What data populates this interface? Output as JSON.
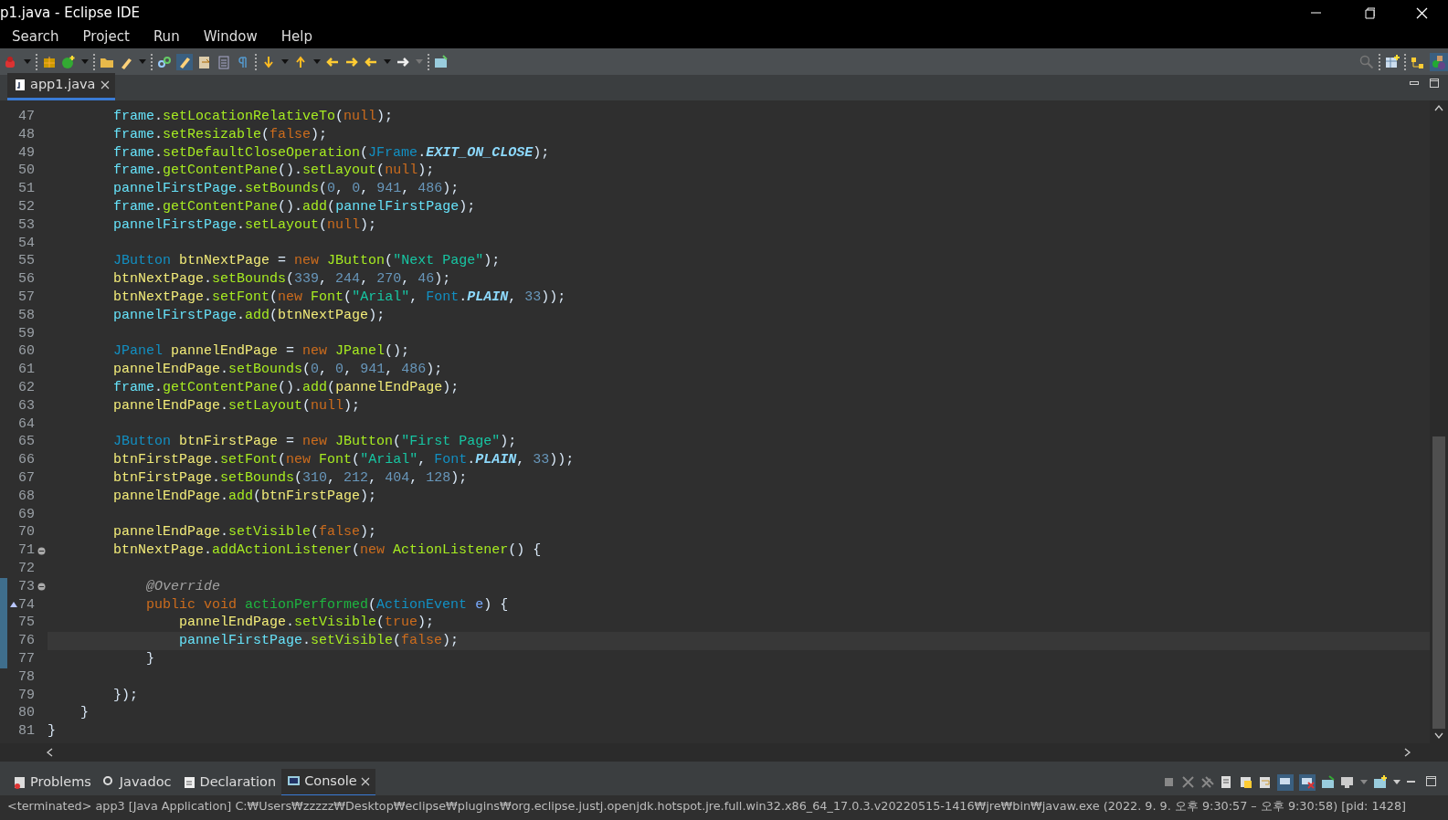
{
  "window": {
    "title": "p1.java - Eclipse IDE"
  },
  "menu": [
    "Search",
    "Project",
    "Run",
    "Window",
    "Help"
  ],
  "editor_tabs": [
    {
      "label": "app1.java",
      "selected": true
    }
  ],
  "code_lines": [
    {
      "number": "47",
      "current": false,
      "changed": false,
      "fold": false,
      "override": false,
      "tokens": [
        {
          "kind": "f",
          "text": "        frame"
        },
        {
          "kind": "p",
          "text": "."
        },
        {
          "kind": "m",
          "text": "setLocationRelativeTo"
        },
        {
          "kind": "p",
          "text": "("
        },
        {
          "kind": "k",
          "text": "null"
        },
        {
          "kind": "p",
          "text": ");"
        }
      ]
    },
    {
      "number": "48",
      "current": false,
      "changed": false,
      "fold": false,
      "override": false,
      "tokens": [
        {
          "kind": "f",
          "text": "        frame"
        },
        {
          "kind": "p",
          "text": "."
        },
        {
          "kind": "m",
          "text": "setResizable"
        },
        {
          "kind": "p",
          "text": "("
        },
        {
          "kind": "k",
          "text": "false"
        },
        {
          "kind": "p",
          "text": ");"
        }
      ]
    },
    {
      "number": "49",
      "current": false,
      "changed": false,
      "fold": false,
      "override": false,
      "tokens": [
        {
          "kind": "f",
          "text": "        frame"
        },
        {
          "kind": "p",
          "text": "."
        },
        {
          "kind": "m",
          "text": "setDefaultCloseOperation"
        },
        {
          "kind": "p",
          "text": "("
        },
        {
          "kind": "t",
          "text": "JFrame"
        },
        {
          "kind": "p",
          "text": "."
        },
        {
          "kind": "c",
          "text": "EXIT_ON_CLOSE"
        },
        {
          "kind": "p",
          "text": ");"
        }
      ]
    },
    {
      "number": "50",
      "current": false,
      "changed": false,
      "fold": false,
      "override": false,
      "tokens": [
        {
          "kind": "f",
          "text": "        frame"
        },
        {
          "kind": "p",
          "text": "."
        },
        {
          "kind": "m",
          "text": "getContentPane"
        },
        {
          "kind": "p",
          "text": "()."
        },
        {
          "kind": "m",
          "text": "setLayout"
        },
        {
          "kind": "p",
          "text": "("
        },
        {
          "kind": "k",
          "text": "null"
        },
        {
          "kind": "p",
          "text": ");"
        }
      ]
    },
    {
      "number": "51",
      "current": false,
      "changed": false,
      "fold": false,
      "override": false,
      "tokens": [
        {
          "kind": "f",
          "text": "        pannelFirstPage"
        },
        {
          "kind": "p",
          "text": "."
        },
        {
          "kind": "m",
          "text": "setBounds"
        },
        {
          "kind": "p",
          "text": "("
        },
        {
          "kind": "n",
          "text": "0"
        },
        {
          "kind": "p",
          "text": ","
        },
        {
          "kind": "n",
          "text": " 0"
        },
        {
          "kind": "p",
          "text": ","
        },
        {
          "kind": "n",
          "text": " 941"
        },
        {
          "kind": "p",
          "text": ","
        },
        {
          "kind": "n",
          "text": " 486"
        },
        {
          "kind": "p",
          "text": ");"
        }
      ]
    },
    {
      "number": "52",
      "current": false,
      "changed": false,
      "fold": false,
      "override": false,
      "tokens": [
        {
          "kind": "f",
          "text": "        frame"
        },
        {
          "kind": "p",
          "text": "."
        },
        {
          "kind": "m",
          "text": "getContentPane"
        },
        {
          "kind": "p",
          "text": "()."
        },
        {
          "kind": "m",
          "text": "add"
        },
        {
          "kind": "p",
          "text": "("
        },
        {
          "kind": "f",
          "text": "pannelFirstPage"
        },
        {
          "kind": "p",
          "text": ");"
        }
      ]
    },
    {
      "number": "53",
      "current": false,
      "changed": false,
      "fold": false,
      "override": false,
      "tokens": [
        {
          "kind": "f",
          "text": "        pannelFirstPage"
        },
        {
          "kind": "p",
          "text": "."
        },
        {
          "kind": "m",
          "text": "setLayout"
        },
        {
          "kind": "p",
          "text": "("
        },
        {
          "kind": "k",
          "text": "null"
        },
        {
          "kind": "p",
          "text": ");"
        }
      ]
    },
    {
      "number": "54",
      "current": false,
      "changed": false,
      "fold": false,
      "override": false
    },
    {
      "number": "55",
      "current": false,
      "changed": false,
      "fold": false,
      "override": false,
      "tokens": [
        {
          "kind": "t",
          "text": "        JButton"
        },
        {
          "kind": "v",
          "text": " btnNextPage"
        },
        {
          "kind": "p",
          "text": " ="
        },
        {
          "kind": "k",
          "text": " new"
        },
        {
          "kind": "m",
          "text": " JButton"
        },
        {
          "kind": "p",
          "text": "("
        },
        {
          "kind": "s",
          "text": "\"Next Page\""
        },
        {
          "kind": "p",
          "text": ");"
        }
      ]
    },
    {
      "number": "56",
      "current": false,
      "changed": false,
      "fold": false,
      "override": false,
      "tokens": [
        {
          "kind": "v",
          "text": "        btnNextPage"
        },
        {
          "kind": "p",
          "text": "."
        },
        {
          "kind": "m",
          "text": "setBounds"
        },
        {
          "kind": "p",
          "text": "("
        },
        {
          "kind": "n",
          "text": "339"
        },
        {
          "kind": "p",
          "text": ","
        },
        {
          "kind": "n",
          "text": " 244"
        },
        {
          "kind": "p",
          "text": ","
        },
        {
          "kind": "n",
          "text": " 270"
        },
        {
          "kind": "p",
          "text": ","
        },
        {
          "kind": "n",
          "text": " 46"
        },
        {
          "kind": "p",
          "text": ");"
        }
      ]
    },
    {
      "number": "57",
      "current": false,
      "changed": false,
      "fold": false,
      "override": false,
      "tokens": [
        {
          "kind": "v",
          "text": "        btnNextPage"
        },
        {
          "kind": "p",
          "text": "."
        },
        {
          "kind": "m",
          "text": "setFont"
        },
        {
          "kind": "p",
          "text": "("
        },
        {
          "kind": "k",
          "text": "new"
        },
        {
          "kind": "m",
          "text": " Font"
        },
        {
          "kind": "p",
          "text": "("
        },
        {
          "kind": "s",
          "text": "\"Arial\""
        },
        {
          "kind": "p",
          "text": ","
        },
        {
          "kind": "t",
          "text": " Font"
        },
        {
          "kind": "p",
          "text": "."
        },
        {
          "kind": "c",
          "text": "PLAIN"
        },
        {
          "kind": "p",
          "text": ","
        },
        {
          "kind": "n",
          "text": " 33"
        },
        {
          "kind": "p",
          "text": "));"
        }
      ]
    },
    {
      "number": "58",
      "current": false,
      "changed": false,
      "fold": false,
      "override": false,
      "tokens": [
        {
          "kind": "f",
          "text": "        pannelFirstPage"
        },
        {
          "kind": "p",
          "text": "."
        },
        {
          "kind": "m",
          "text": "add"
        },
        {
          "kind": "p",
          "text": "("
        },
        {
          "kind": "v",
          "text": "btnNextPage"
        },
        {
          "kind": "p",
          "text": ");"
        }
      ]
    },
    {
      "number": "59",
      "current": false,
      "changed": false,
      "fold": false,
      "override": false
    },
    {
      "number": "60",
      "current": false,
      "changed": false,
      "fold": false,
      "override": false,
      "tokens": [
        {
          "kind": "t",
          "text": "        JPanel"
        },
        {
          "kind": "v",
          "text": " pannelEndPage"
        },
        {
          "kind": "p",
          "text": " ="
        },
        {
          "kind": "k",
          "text": " new"
        },
        {
          "kind": "m",
          "text": " JPanel"
        },
        {
          "kind": "p",
          "text": "();"
        }
      ]
    },
    {
      "number": "61",
      "current": false,
      "changed": false,
      "fold": false,
      "override": false,
      "tokens": [
        {
          "kind": "v",
          "text": "        pannelEndPage"
        },
        {
          "kind": "p",
          "text": "."
        },
        {
          "kind": "m",
          "text": "setBounds"
        },
        {
          "kind": "p",
          "text": "("
        },
        {
          "kind": "n",
          "text": "0"
        },
        {
          "kind": "p",
          "text": ","
        },
        {
          "kind": "n",
          "text": " 0"
        },
        {
          "kind": "p",
          "text": ","
        },
        {
          "kind": "n",
          "text": " 941"
        },
        {
          "kind": "p",
          "text": ","
        },
        {
          "kind": "n",
          "text": " 486"
        },
        {
          "kind": "p",
          "text": ");"
        }
      ]
    },
    {
      "number": "62",
      "current": false,
      "changed": false,
      "fold": false,
      "override": false,
      "tokens": [
        {
          "kind": "f",
          "text": "        frame"
        },
        {
          "kind": "p",
          "text": "."
        },
        {
          "kind": "m",
          "text": "getContentPane"
        },
        {
          "kind": "p",
          "text": "()."
        },
        {
          "kind": "m",
          "text": "add"
        },
        {
          "kind": "p",
          "text": "("
        },
        {
          "kind": "v",
          "text": "pannelEndPage"
        },
        {
          "kind": "p",
          "text": ");"
        }
      ]
    },
    {
      "number": "63",
      "current": false,
      "changed": false,
      "fold": false,
      "override": false,
      "tokens": [
        {
          "kind": "v",
          "text": "        pannelEndPage"
        },
        {
          "kind": "p",
          "text": "."
        },
        {
          "kind": "m",
          "text": "setLayout"
        },
        {
          "kind": "p",
          "text": "("
        },
        {
          "kind": "k",
          "text": "null"
        },
        {
          "kind": "p",
          "text": ");"
        }
      ]
    },
    {
      "number": "64",
      "current": false,
      "changed": false,
      "fold": false,
      "override": false
    },
    {
      "number": "65",
      "current": false,
      "changed": false,
      "fold": false,
      "override": false,
      "tokens": [
        {
          "kind": "t",
          "text": "        JButton"
        },
        {
          "kind": "v",
          "text": " btnFirstPage"
        },
        {
          "kind": "p",
          "text": " ="
        },
        {
          "kind": "k",
          "text": " new"
        },
        {
          "kind": "m",
          "text": " JButton"
        },
        {
          "kind": "p",
          "text": "("
        },
        {
          "kind": "s",
          "text": "\"First Page\""
        },
        {
          "kind": "p",
          "text": ");"
        }
      ]
    },
    {
      "number": "66",
      "current": false,
      "changed": false,
      "fold": false,
      "override": false,
      "tokens": [
        {
          "kind": "v",
          "text": "        btnFirstPage"
        },
        {
          "kind": "p",
          "text": "."
        },
        {
          "kind": "m",
          "text": "setFont"
        },
        {
          "kind": "p",
          "text": "("
        },
        {
          "kind": "k",
          "text": "new"
        },
        {
          "kind": "m",
          "text": " Font"
        },
        {
          "kind": "p",
          "text": "("
        },
        {
          "kind": "s",
          "text": "\"Arial\""
        },
        {
          "kind": "p",
          "text": ","
        },
        {
          "kind": "t",
          "text": " Font"
        },
        {
          "kind": "p",
          "text": "."
        },
        {
          "kind": "c",
          "text": "PLAIN"
        },
        {
          "kind": "p",
          "text": ","
        },
        {
          "kind": "n",
          "text": " 33"
        },
        {
          "kind": "p",
          "text": "));"
        }
      ]
    },
    {
      "number": "67",
      "current": false,
      "changed": false,
      "fold": false,
      "override": false,
      "tokens": [
        {
          "kind": "v",
          "text": "        btnFirstPage"
        },
        {
          "kind": "p",
          "text": "."
        },
        {
          "kind": "m",
          "text": "setBounds"
        },
        {
          "kind": "p",
          "text": "("
        },
        {
          "kind": "n",
          "text": "310"
        },
        {
          "kind": "p",
          "text": ","
        },
        {
          "kind": "n",
          "text": " 212"
        },
        {
          "kind": "p",
          "text": ","
        },
        {
          "kind": "n",
          "text": " 404"
        },
        {
          "kind": "p",
          "text": ","
        },
        {
          "kind": "n",
          "text": " 128"
        },
        {
          "kind": "p",
          "text": ");"
        }
      ]
    },
    {
      "number": "68",
      "current": false,
      "changed": false,
      "fold": false,
      "override": false,
      "tokens": [
        {
          "kind": "v",
          "text": "        pannelEndPage"
        },
        {
          "kind": "p",
          "text": "."
        },
        {
          "kind": "m",
          "text": "add"
        },
        {
          "kind": "p",
          "text": "("
        },
        {
          "kind": "v",
          "text": "btnFirstPage"
        },
        {
          "kind": "p",
          "text": ");"
        }
      ]
    },
    {
      "number": "69",
      "current": false,
      "changed": false,
      "fold": false,
      "override": false
    },
    {
      "number": "70",
      "current": false,
      "changed": false,
      "fold": false,
      "override": false,
      "tokens": [
        {
          "kind": "v",
          "text": "        pannelEndPage"
        },
        {
          "kind": "p",
          "text": "."
        },
        {
          "kind": "m",
          "text": "setVisible"
        },
        {
          "kind": "p",
          "text": "("
        },
        {
          "kind": "k",
          "text": "false"
        },
        {
          "kind": "p",
          "text": ");"
        }
      ]
    },
    {
      "number": "71",
      "current": false,
      "changed": false,
      "fold": true,
      "override": false,
      "tokens": [
        {
          "kind": "v",
          "text": "        btnNextPage"
        },
        {
          "kind": "p",
          "text": "."
        },
        {
          "kind": "m",
          "text": "addActionListener"
        },
        {
          "kind": "p",
          "text": "("
        },
        {
          "kind": "k",
          "text": "new"
        },
        {
          "kind": "m",
          "text": " ActionListener"
        },
        {
          "kind": "p",
          "text": "() {"
        }
      ]
    },
    {
      "number": "72",
      "current": false,
      "changed": false,
      "fold": false,
      "override": false
    },
    {
      "number": "73",
      "current": false,
      "changed": true,
      "fold": true,
      "override": false,
      "tokens": [
        {
          "kind": "a",
          "text": "            @Override"
        }
      ]
    },
    {
      "number": "74",
      "current": false,
      "changed": true,
      "fold": false,
      "override": true,
      "tokens": [
        {
          "kind": "k",
          "text": "            public"
        },
        {
          "kind": "k",
          "text": " void"
        },
        {
          "kind": "d",
          "text": " actionPerformed"
        },
        {
          "kind": "p",
          "text": "("
        },
        {
          "kind": "t",
          "text": "ActionEvent"
        },
        {
          "kind": "r",
          "text": " e"
        },
        {
          "kind": "p",
          "text": ") {"
        }
      ]
    },
    {
      "number": "75",
      "current": false,
      "changed": true,
      "fold": false,
      "override": false,
      "tokens": [
        {
          "kind": "v",
          "text": "                pannelEndPage"
        },
        {
          "kind": "p",
          "text": "."
        },
        {
          "kind": "m",
          "text": "setVisible"
        },
        {
          "kind": "p",
          "text": "("
        },
        {
          "kind": "k",
          "text": "true"
        },
        {
          "kind": "p",
          "text": ");"
        }
      ]
    },
    {
      "number": "76",
      "current": true,
      "changed": true,
      "fold": false,
      "override": false,
      "tokens": [
        {
          "kind": "f",
          "text": "                pannelFirstPage"
        },
        {
          "kind": "p",
          "text": "."
        },
        {
          "kind": "m",
          "text": "setVisible"
        },
        {
          "kind": "p",
          "text": "("
        },
        {
          "kind": "k",
          "text": "false"
        },
        {
          "kind": "p",
          "text": ");"
        }
      ]
    },
    {
      "number": "77",
      "current": false,
      "changed": true,
      "fold": false,
      "override": false,
      "tokens": [
        {
          "kind": "p",
          "text": "            }"
        }
      ]
    },
    {
      "number": "78",
      "current": false,
      "changed": false,
      "fold": false,
      "override": false
    },
    {
      "number": "79",
      "current": false,
      "changed": false,
      "fold": false,
      "override": false,
      "tokens": [
        {
          "kind": "p",
          "text": "        });"
        }
      ]
    },
    {
      "number": "80",
      "current": false,
      "changed": false,
      "fold": false,
      "override": false,
      "tokens": [
        {
          "kind": "p",
          "text": "    }"
        }
      ]
    },
    {
      "number": "81",
      "current": false,
      "changed": false,
      "fold": false,
      "override": false,
      "tokens": [
        {
          "kind": "p",
          "text": "}"
        }
      ]
    }
  ],
  "bottom_tabs": [
    {
      "label": "Problems",
      "selected": false,
      "closable": false
    },
    {
      "label": "Javadoc",
      "selected": false,
      "closable": false
    },
    {
      "label": "Declaration",
      "selected": false,
      "closable": false
    },
    {
      "label": "Console",
      "selected": true,
      "closable": true
    }
  ],
  "console": {
    "status_line": "<terminated> app3 [Java Application] C:₩Users₩zzzzz₩Desktop₩eclipse₩plugins₩org.eclipse.justj.openjdk.hotspot.jre.full.win32.x86_64_17.0.3.v20220515-1416₩jre₩bin₩javaw.exe  (2022. 9. 9. 오후 9:30:57 – 오후 9:30:58) [pid: 1428]"
  }
}
